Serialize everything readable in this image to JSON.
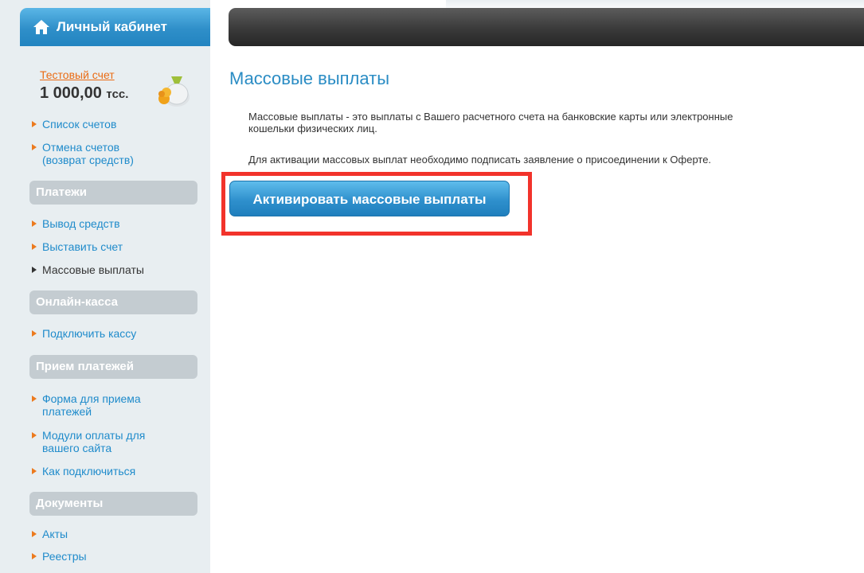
{
  "sidebar": {
    "header_title": "Личный кабинет",
    "account_link": "Тестовый счет",
    "balance_amount": "1 000,00",
    "balance_currency": "тсс.",
    "account_items": [
      "Список счетов",
      "Отмена счетов",
      "(возврат средств)"
    ],
    "sections": {
      "payments": {
        "title": "Платежи",
        "items": [
          "Вывод средств",
          "Выставить счет",
          "Массовые выплаты"
        ]
      },
      "online_cash": {
        "title": "Онлайн-касса",
        "items": [
          "Подключить кассу"
        ]
      },
      "accept_payments": {
        "title": "Прием платежей",
        "items": [
          "Форма для приема",
          "платежей",
          "Модули оплаты для",
          "вашего сайта",
          "Как подключиться"
        ]
      },
      "documents": {
        "title": "Документы",
        "items": [
          "Акты",
          "Реестры"
        ]
      }
    }
  },
  "main": {
    "title": "Массовые выплаты",
    "description_line1": "Массовые выплаты - это выплаты с Вашего расчетного счета на банковские карты или электронные",
    "description_line2": "кошельки физических лиц.",
    "activation_note": "Для активации массовых выплат необходимо подписать заявление о присоединении к Оферте.",
    "activate_button": "Активировать массовые выплаты"
  },
  "colors": {
    "accent_blue": "#2a8cc4",
    "link_orange": "#ea6b13",
    "highlight_red": "#f2332b"
  }
}
